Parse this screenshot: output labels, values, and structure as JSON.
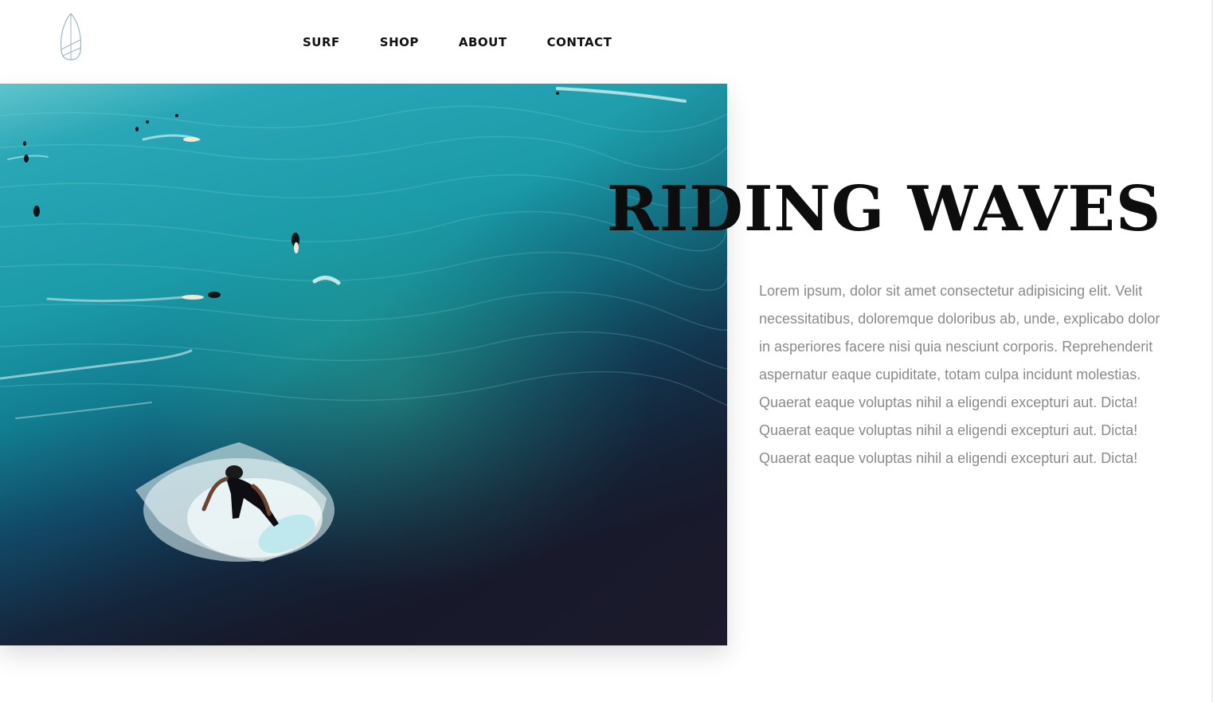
{
  "header": {
    "logo_icon": "surfboard-icon",
    "nav": [
      {
        "label": "SURF"
      },
      {
        "label": "SHOP"
      },
      {
        "label": "ABOUT"
      },
      {
        "label": "CONTACT"
      }
    ]
  },
  "hero": {
    "image": "surfers-aerial-ocean-photo",
    "title": "RIDING WAVES",
    "body": "Lorem ipsum, dolor sit amet consectetur adipisicing elit. Velit necessitatibus, doloremque doloribus ab, unde, explicabo dolor in asperiores facere nisi quia nesciunt corporis. Reprehenderit aspernatur eaque cupiditate, totam culpa incidunt molestias. Quaerat eaque voluptas nihil a eligendi excepturi aut. Dicta! Quaerat eaque voluptas nihil a eligendi excepturi aut. Dicta! Quaerat eaque voluptas nihil a eligendi excepturi aut. Dicta!"
  },
  "colors": {
    "title": "#0d0d0d",
    "body_text": "#8a8a8a",
    "nav_text": "#111111",
    "ocean_light": "#1fa6b4",
    "ocean_dark": "#172033"
  }
}
